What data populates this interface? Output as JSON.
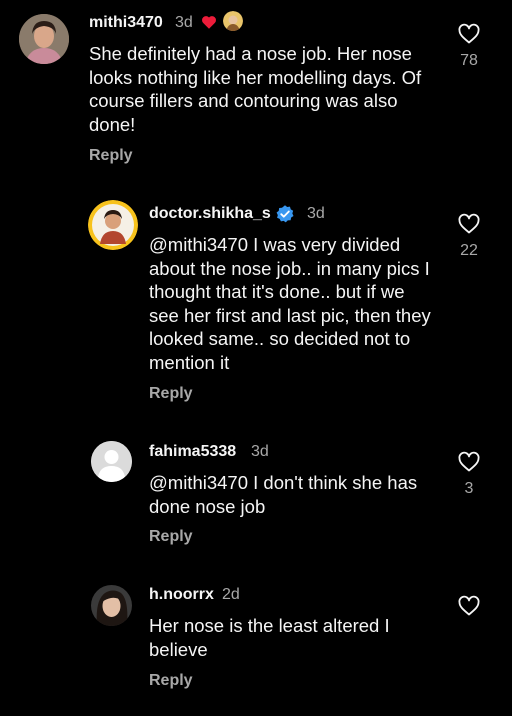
{
  "comments": [
    {
      "username": "mithi3470",
      "time": "3d",
      "text": "She definitely had a nose job. Her nose looks nothing like her modelling days. Of course fillers and contouring was also done!",
      "reply": "Reply",
      "likes": "78"
    },
    {
      "username": "doctor.shikha_s",
      "time": "3d",
      "text": "@mithi3470 I was very divided about the nose job.. in many pics I thought that it's done.. but if we see her first and last pic, then they looked same.. so decided not to mention it",
      "reply": "Reply",
      "likes": "22"
    },
    {
      "username": "fahima5338",
      "time": "3d",
      "text": "@mithi3470 I don't think she has done nose job",
      "reply": "Reply",
      "likes": "3"
    },
    {
      "username": "h.noorrx",
      "time": "2d",
      "text": "Her nose is the least altered I believe",
      "reply": "Reply",
      "likes": ""
    }
  ],
  "icons": {
    "like": "heart-outline-icon",
    "verified": "verified-badge-icon",
    "heart_emoji": "red-heart-icon"
  },
  "colors": {
    "background": "#000000",
    "text": "#f5f5f5",
    "secondary": "#a8a8a8",
    "verified": "#3897f0",
    "heart": "#ed1c3a"
  }
}
